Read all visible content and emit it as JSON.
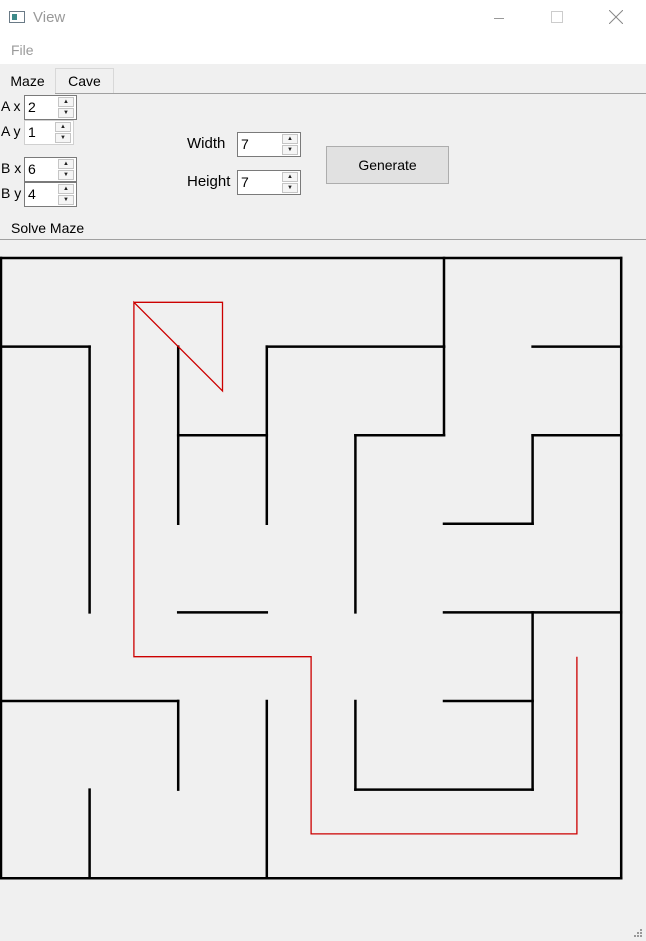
{
  "window": {
    "title": "View",
    "minimize_icon": "minimize-icon",
    "maximize_icon": "maximize-icon",
    "close_icon": "close-icon"
  },
  "menu": {
    "file": "File"
  },
  "tabs": [
    {
      "label": "Maze",
      "active": true
    },
    {
      "label": "Cave",
      "active": false
    }
  ],
  "controls": {
    "ax": {
      "label": "A x",
      "value": "2"
    },
    "ay": {
      "label": "A y",
      "value": "1"
    },
    "bx": {
      "label": "B x",
      "value": "6"
    },
    "by": {
      "label": "B y",
      "value": "4"
    },
    "width": {
      "label": "Width",
      "value": "7"
    },
    "height": {
      "label": "Height",
      "value": "7"
    },
    "generate": "Generate",
    "solve": "Solve Maze"
  },
  "maze": {
    "cols": 7,
    "rows": 7,
    "wall_color": "#000000",
    "path_color": "#cc0000",
    "walls": [
      [
        [
          0,
          0
        ],
        [
          7,
          0
        ]
      ],
      [
        [
          7,
          0
        ],
        [
          7,
          7
        ]
      ],
      [
        [
          0,
          7
        ],
        [
          7,
          7
        ]
      ],
      [
        [
          0,
          0
        ],
        [
          0,
          7
        ]
      ],
      [
        [
          5,
          0
        ],
        [
          5,
          1
        ]
      ],
      [
        [
          0,
          1
        ],
        [
          1,
          1
        ]
      ],
      [
        [
          1,
          1
        ],
        [
          1,
          4
        ]
      ],
      [
        [
          2,
          1
        ],
        [
          2,
          3
        ]
      ],
      [
        [
          2,
          2
        ],
        [
          3,
          2
        ]
      ],
      [
        [
          3,
          1
        ],
        [
          3,
          3
        ]
      ],
      [
        [
          3,
          1
        ],
        [
          5,
          1
        ]
      ],
      [
        [
          5,
          1
        ],
        [
          5,
          2
        ]
      ],
      [
        [
          4,
          2
        ],
        [
          5,
          2
        ]
      ],
      [
        [
          4,
          2
        ],
        [
          4,
          4
        ]
      ],
      [
        [
          6,
          1
        ],
        [
          7,
          1
        ]
      ],
      [
        [
          6,
          2
        ],
        [
          7,
          2
        ]
      ],
      [
        [
          6,
          2
        ],
        [
          6,
          3
        ]
      ],
      [
        [
          5,
          3
        ],
        [
          6,
          3
        ]
      ],
      [
        [
          2,
          4
        ],
        [
          3,
          4
        ]
      ],
      [
        [
          5,
          4
        ],
        [
          7,
          4
        ]
      ],
      [
        [
          6,
          4
        ],
        [
          6,
          6
        ]
      ],
      [
        [
          5,
          5
        ],
        [
          6,
          5
        ]
      ],
      [
        [
          4,
          5
        ],
        [
          4,
          6
        ]
      ],
      [
        [
          4,
          6
        ],
        [
          6,
          6
        ]
      ],
      [
        [
          0,
          5
        ],
        [
          2,
          5
        ]
      ],
      [
        [
          2,
          5
        ],
        [
          2,
          6
        ]
      ],
      [
        [
          3,
          5
        ],
        [
          3,
          7
        ]
      ],
      [
        [
          1,
          6
        ],
        [
          1,
          7
        ]
      ]
    ],
    "solution_path": [
      [
        1.5,
        0.5
      ],
      [
        2.5,
        0.5
      ],
      [
        2.5,
        1.5
      ],
      [
        1.5,
        0.5
      ],
      [
        1.5,
        4.5
      ],
      [
        3.5,
        4.5
      ],
      [
        3.5,
        6.5
      ],
      [
        6.5,
        6.5
      ],
      [
        6.5,
        4.5
      ]
    ]
  }
}
